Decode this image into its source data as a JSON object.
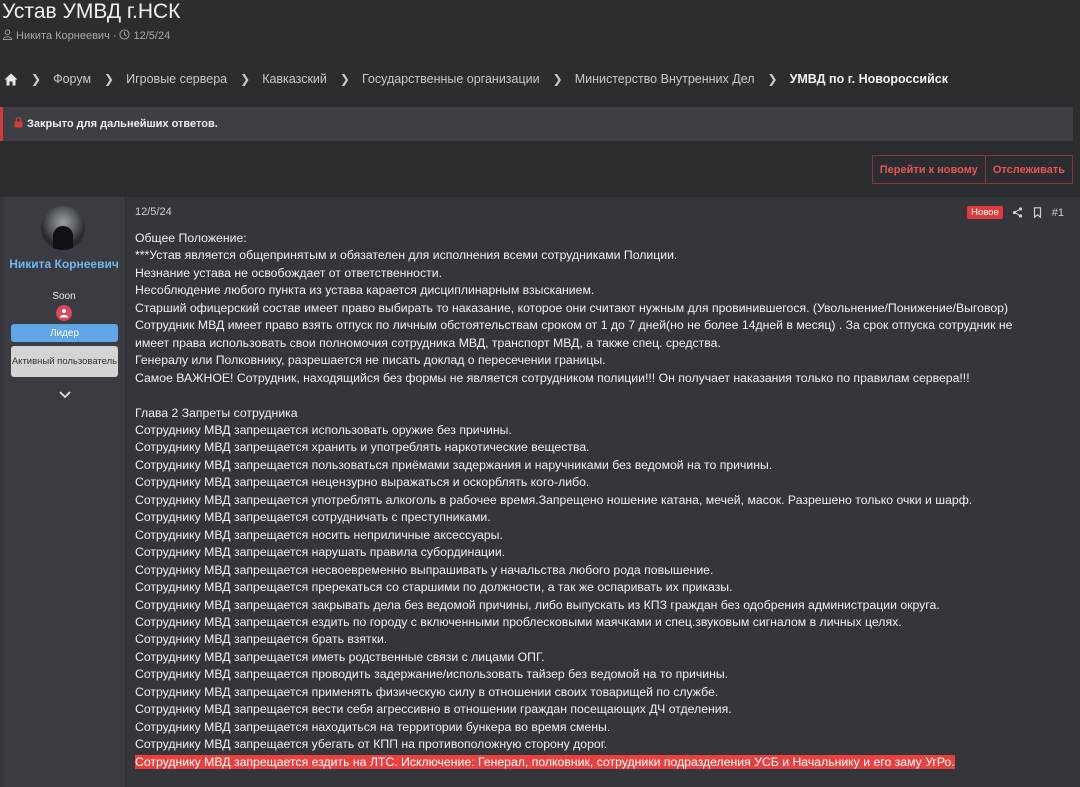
{
  "thread": {
    "title": "Устав УМВД г.НСК",
    "author": "Никита Корнеевич",
    "date": "12/5/24"
  },
  "breadcrumbs": [
    "Форум",
    "Игровые сервера",
    "Кавказский",
    "Государственные организации",
    "Министерство Внутренних Дел",
    "УМВД по г. Новороссийск"
  ],
  "notice": "Закрыто для дальнейших ответов.",
  "buttons": {
    "goto_new": "Перейти к новому",
    "watch": "Отслеживать"
  },
  "colors": {
    "accent": "#e45555",
    "username": "#6fb8ef",
    "highlight": "#e8413e",
    "role_leader": "#5fa6e6"
  },
  "user": {
    "name": "Никита Корнеевич",
    "title": "Soon",
    "roles": [
      "Лидер",
      "Активный пользователь"
    ]
  },
  "post": {
    "date": "12/5/24",
    "new_badge": "Новое",
    "number": "#1",
    "lines": [
      "Общее Положение:",
      "***Устав является общепринятым и обязателен для исполнения всеми сотрудниками Полиции.",
      "Незнание устава не освобождает от ответственности.",
      "Несоблюдение любого пункта из устава карается дисциплинарным взысканием.",
      "Старший офицерский состав имеет право выбирать то наказание, которое они считают нужным для провинившегося. (Увольнение/Понижение/Выговор)",
      "Сотрудник МВД имеет право взять отпуск по личным обстоятельствам сроком от 1 до 7 дней(но не более 14дней в месяц) . За срок отпуска сотрудник не",
      "имеет права использовать свои полномочия сотрудника МВД, транспорт МВД, а также спец. средства.",
      "Генералу или Полковнику, разрешается не писать доклад о пересечении границы.",
      "Самое ВАЖНОЕ! Сотрудник, находящийся без формы не является сотрудником полиции!!! Он получает наказания только по правилам сервера!!!",
      "",
      "Глава 2 Запреты сотрудника",
      "Сотруднику МВД запрещается использовать оружие без причины.",
      "Сотруднику МВД запрещается хранить и употреблять наркотические вещества.",
      "Сотруднику МВД запрещается пользоваться приёмами задержания и наручниками без ведомой на то причины.",
      "Сотруднику МВД запрещается нецензурно выражаться и оскорблять кого-либо.",
      "Сотруднику МВД запрещается употреблять алкоголь в рабочее время.Запрещено ношение катана, мечей, масок. Разрешено только очки и шарф.",
      "Сотруднику МВД запрещается сотрудничать с преступниками.",
      "Сотруднику МВД запрещается носить неприличные аксессуары.",
      "Сотруднику МВД запрещается нарушать правила субординации.",
      "Сотруднику МВД запрещается несвоевременно выпрашивать у начальства любого рода повышение.",
      "Сотруднику МВД запрещается пререкаться со старшими по должности, а так же оспаривать их приказы.",
      "Сотруднику МВД запрещается закрывать дела без ведомой причины, либо выпускать из КПЗ граждан без одобрения администрации округа.",
      "Сотруднику МВД запрещается ездить по городу с включенными проблесковыми маячками и спец.звуковым сигналом в личных целях.",
      "Сотруднику МВД запрещается брать взятки.",
      "Сотруднику МВД запрещается иметь родственные связи с лицами ОПГ.",
      "Сотруднику МВД запрещается проводить задержание/использовать тайзер без ведомой на то причины.",
      "Сотруднику МВД запрещается применять физическую силу в отношении своих товарищей по службе.",
      "Сотруднику МВД запрещается вести себя агрессивно в отношении граждан посещающих ДЧ отделения.",
      "Сотруднику МВД запрещается находиться на территории бункера во время смены.",
      "Сотруднику МВД запрещается убегать от КПП на противоположную сторону дорог."
    ],
    "highlighted_line": "Сотруднику МВД запрещается ездить на ЛТС. Исключение: Генерал, полковник, сотрудники подразделения УСБ и Начальнику и его заму УгРо."
  }
}
